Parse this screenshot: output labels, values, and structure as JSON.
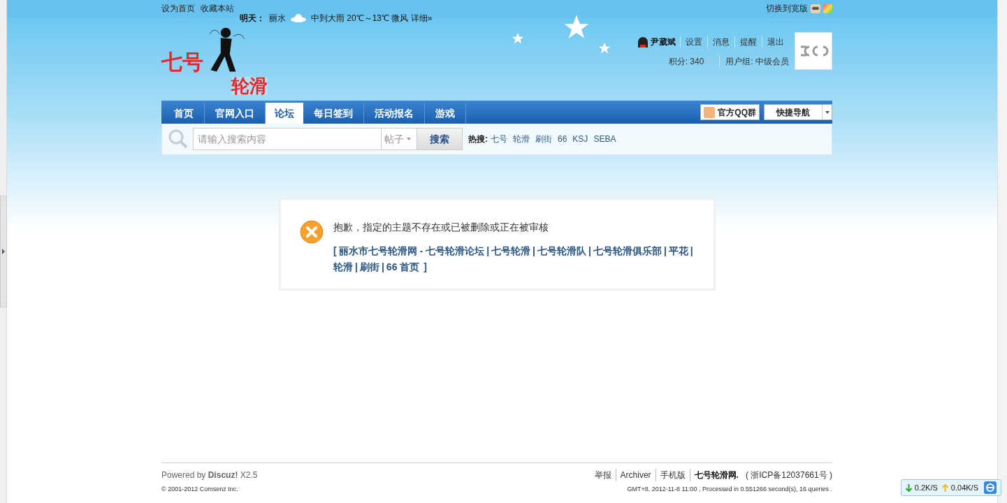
{
  "topbar": {
    "links": [
      "设为首页",
      "收藏本站"
    ],
    "weather": {
      "day": "明天：",
      "city": "丽水",
      "forecast": "中到大雨 20℃～13℃ 微风 详细»"
    },
    "switch": "切换到宽版"
  },
  "logo": {
    "line1": "七号",
    "line2": "轮滑"
  },
  "user": {
    "name": "尹葳斌",
    "links": [
      "设置",
      "消息",
      "提醒",
      "退出"
    ],
    "credits": "积分: 340",
    "group": "用户组: 中级会员"
  },
  "nav": {
    "items": [
      {
        "label": "首页",
        "selected": false
      },
      {
        "label": "官网入口",
        "selected": false
      },
      {
        "label": "论坛",
        "selected": true
      },
      {
        "label": "每日签到",
        "selected": false
      },
      {
        "label": "活动报名",
        "selected": false
      },
      {
        "label": "游戏",
        "selected": false
      }
    ],
    "qq_group": "官方QQ群",
    "quick_nav": "快捷导航"
  },
  "search": {
    "placeholder": "请输入搜索内容",
    "type": "帖子",
    "button": "搜索",
    "hot_label": "热搜:",
    "hot": [
      "七号",
      "轮滑",
      "刷街",
      "66",
      "KSJ",
      "SEBA"
    ]
  },
  "message": {
    "text": "抱歉，指定的主题不存在或已被删除或正在被审核",
    "open": "[",
    "close": "]",
    "separator": "|",
    "links": [
      "丽水市七号轮滑网 - 七号轮滑论坛",
      "七号轮滑",
      "七号轮滑队",
      "七号轮滑俱乐部",
      "平花",
      "轮滑",
      "刷街",
      "66 首页"
    ]
  },
  "footer": {
    "powered": "Powered by **Discuz!** X2.5",
    "copyright": "© 2001-2012 Comsenz Inc.",
    "links": [
      {
        "label": "举报",
        "bold": false
      },
      {
        "label": "Archiver",
        "bold": false
      },
      {
        "label": "手机版",
        "bold": false
      },
      {
        "label": "七号轮滑网.",
        "bold": true
      }
    ],
    "icp": "( 浙ICP备12037661号 )",
    "stats": "GMT+8, 2012-11-8 11:00 , Processed in 0.551266 second(s), 16 queries ."
  },
  "netspeed": {
    "down": "0.2K/S",
    "up": "0.04K/S"
  }
}
